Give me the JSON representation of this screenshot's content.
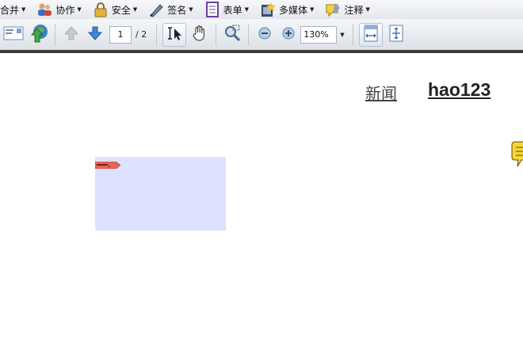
{
  "menu": [
    {
      "label": "合并",
      "icon": "merge-icon"
    },
    {
      "label": "协作",
      "icon": "users-icon"
    },
    {
      "label": "安全",
      "icon": "lock-icon"
    },
    {
      "label": "签名",
      "icon": "pen-icon"
    },
    {
      "label": "表单",
      "icon": "form-icon"
    },
    {
      "label": "多媒体",
      "icon": "film-icon"
    },
    {
      "label": "注释",
      "icon": "comment-icon"
    }
  ],
  "toolbar": {
    "page_current": "1",
    "page_total": "/ 2",
    "zoom": "130%"
  },
  "document": {
    "link_news": "新闻",
    "link_hao": "hao123"
  },
  "colors": {
    "highlight_rect": "#dde2fe",
    "tag": "#e8645a",
    "note": "#f5d530"
  }
}
